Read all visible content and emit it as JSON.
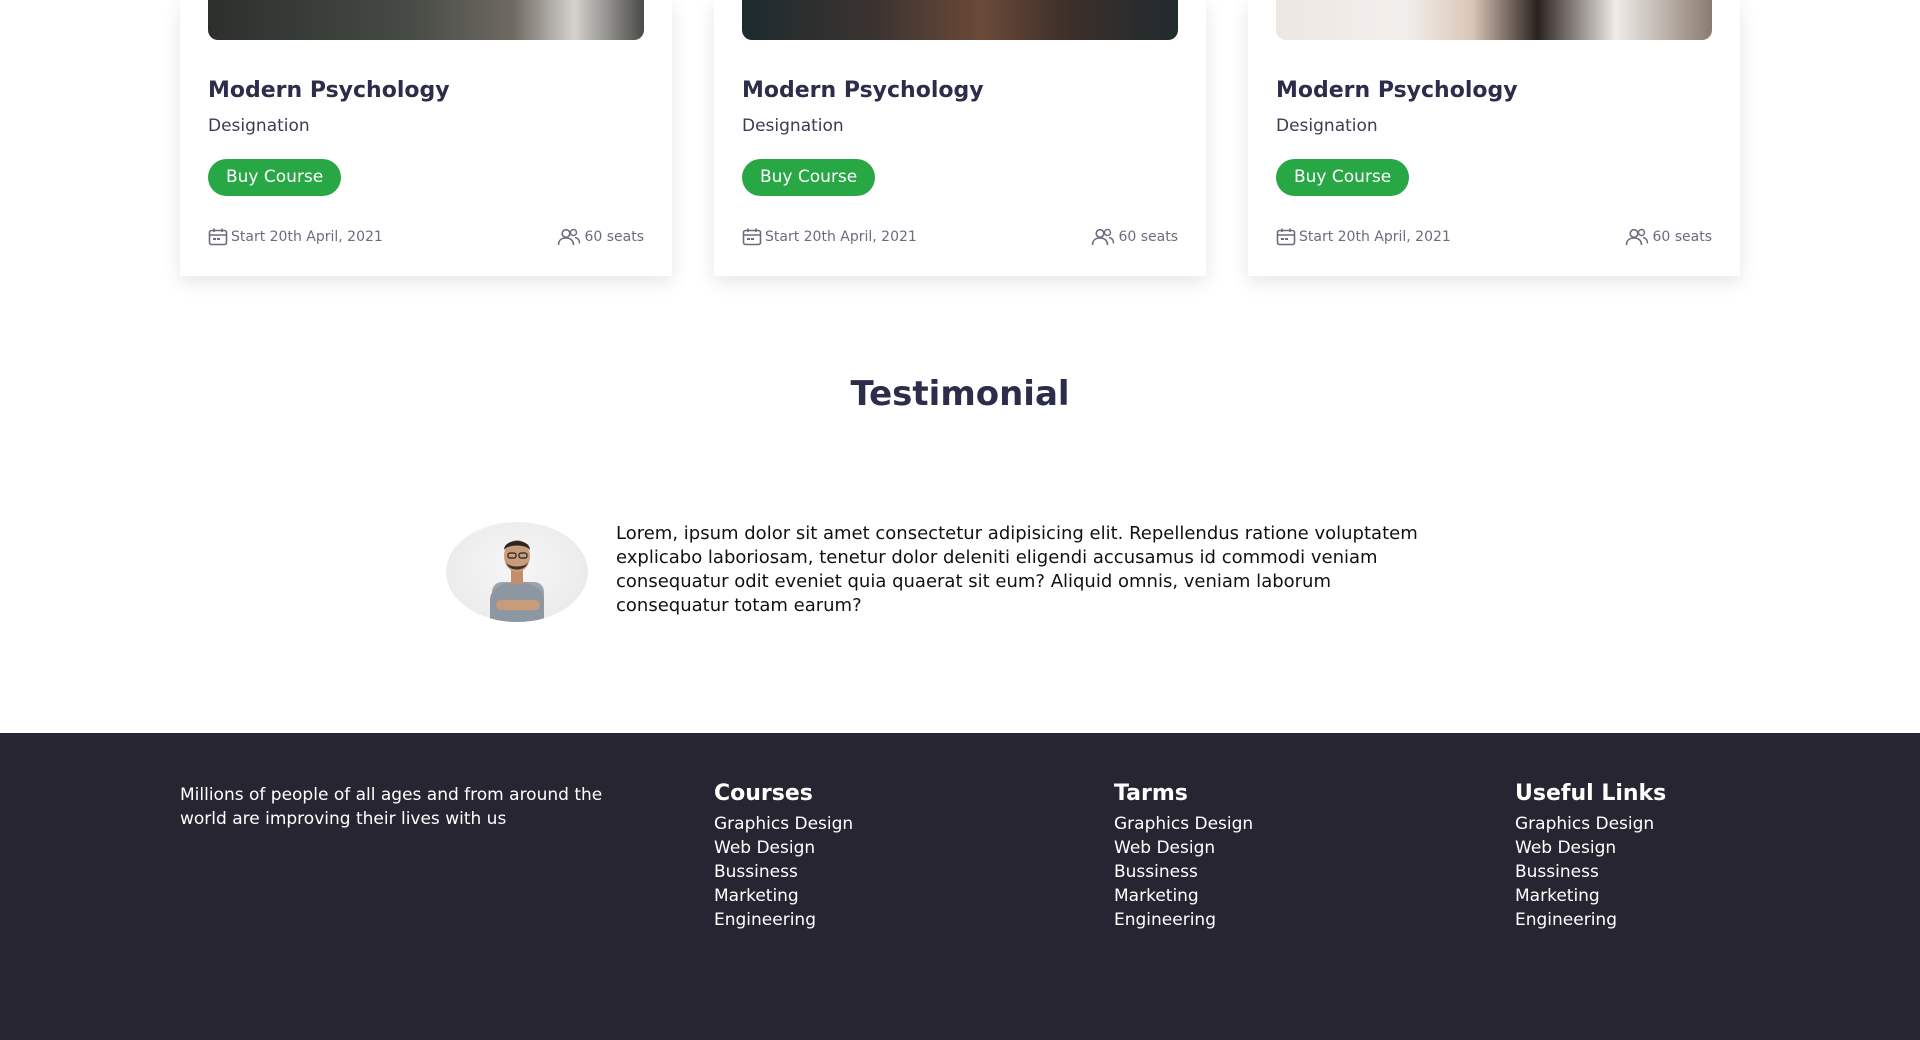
{
  "courses": [
    {
      "title": "Modern Psychology",
      "designation": "Designation",
      "button": "Buy Course",
      "start": "Start 20th April, 2021",
      "seats": "60 seats"
    },
    {
      "title": "Modern Psychology",
      "designation": "Designation",
      "button": "Buy Course",
      "start": "Start 20th April, 2021",
      "seats": "60 seats"
    },
    {
      "title": "Modern Psychology",
      "designation": "Designation",
      "button": "Buy Course",
      "start": "Start 20th April, 2021",
      "seats": "60 seats"
    }
  ],
  "testimonial": {
    "heading": "Testimonial",
    "text": "Lorem, ipsum dolor sit amet consectetur adipisicing elit. Repellendus ratione voluptatem explicabo laboriosam, tenetur dolor deleniti eligendi accusamus id commodi veniam consequatur odit eveniet quia quaerat sit eum? Aliquid omnis, veniam laborum consequatur totam earum?"
  },
  "footer": {
    "about": "Millions of people of all ages and from around the world are improving their lives with us",
    "columns": [
      {
        "title": "Courses",
        "links": [
          "Graphics Design",
          "Web Design",
          "Bussiness",
          "Marketing",
          "Engineering"
        ]
      },
      {
        "title": "Tarms",
        "links": [
          "Graphics Design",
          "Web Design",
          "Bussiness",
          "Marketing",
          "Engineering"
        ]
      },
      {
        "title": "Useful Links",
        "links": [
          "Graphics Design",
          "Web Design",
          "Bussiness",
          "Marketing",
          "Engineering"
        ]
      }
    ]
  },
  "colors": {
    "accent_green": "#28a745",
    "heading": "#2b2d4a",
    "footer_bg": "#272532"
  },
  "icons": {
    "date": "calendar-icon",
    "seats": "users-icon"
  }
}
